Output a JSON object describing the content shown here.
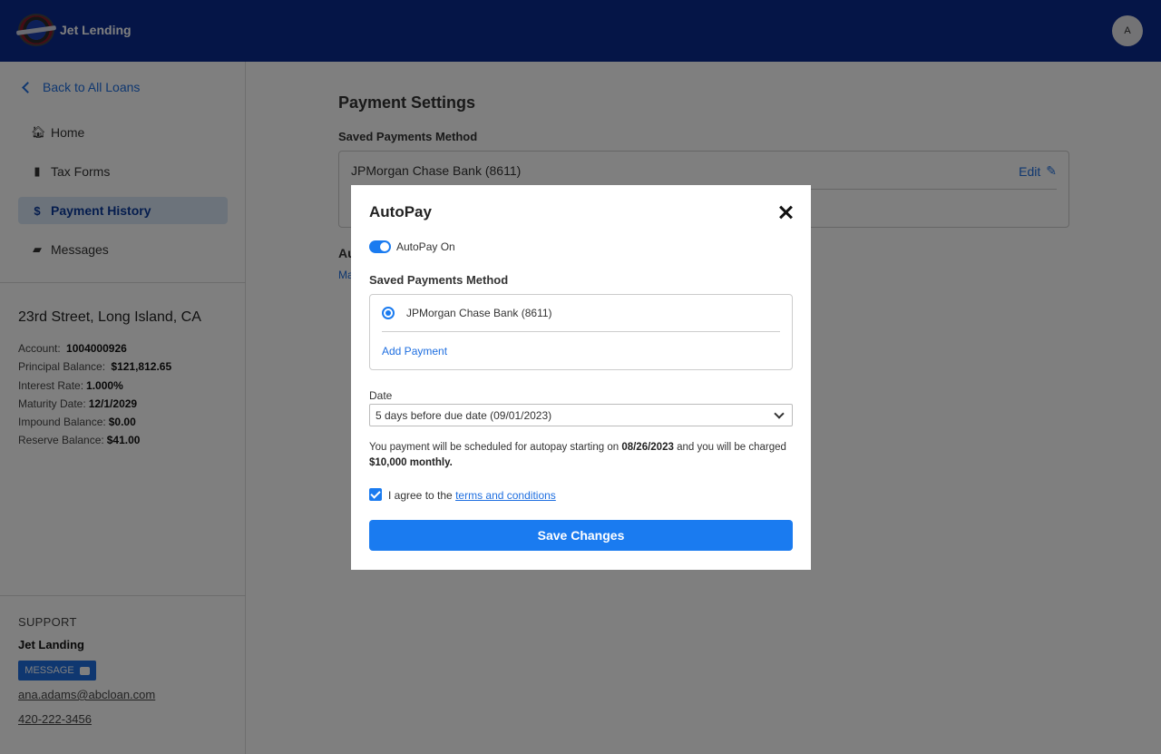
{
  "header": {
    "brand": "Jet Lending",
    "avatar_initial": "A"
  },
  "sidebar": {
    "back_label": "Back to All Loans",
    "items": [
      {
        "label": "Home",
        "icon": "home-icon",
        "active": false
      },
      {
        "label": "Tax Forms",
        "icon": "document-icon",
        "active": false
      },
      {
        "label": "Payment History",
        "icon": "dollar-icon",
        "active": true
      },
      {
        "label": "Messages",
        "icon": "chat-icon",
        "active": false
      }
    ],
    "address": "23rd Street, Long Island, CA",
    "loan": {
      "account_label": "Account:",
      "account_value": "1004000926",
      "principal_label": "Principal Balance:",
      "principal_value": "$121,812.65",
      "interest_label": "Interest Rate:",
      "interest_value": "1.000%",
      "maturity_label": "Maturity Date:",
      "maturity_value": "12/1/2029",
      "impound_label": "Impound Balance:",
      "impound_value": "$0.00",
      "reserve_label": "Reserve Balance:",
      "reserve_value": "$41.00"
    },
    "support": {
      "heading": "SUPPORT",
      "name": "Jet Landing",
      "message_button": "MESSAGE",
      "email": "ana.adams@abcloan.com",
      "phone": "420-222-3456"
    }
  },
  "main": {
    "title": "Payment Settings",
    "saved_heading": "Saved Payments Method",
    "saved_bank": "JPMorgan Chase Bank (8611)",
    "edit_label": "Edit",
    "autopay_fragment": "Au",
    "manage_fragment": "Ma"
  },
  "modal": {
    "title": "AutoPay",
    "toggle_label": "AutoPay On",
    "toggle_on": true,
    "saved_heading": "Saved Payments Method",
    "bank": "JPMorgan Chase Bank (8611)",
    "add_payment": "Add Payment",
    "date_label": "Date",
    "date_value": "5 days before due date (09/01/2023)",
    "note_prefix": "You payment will be scheduled for autopay starting on ",
    "note_date": "08/26/2023",
    "note_mid": " and you will be charged ",
    "note_amount": "$10,000 monthly.",
    "agree_prefix": "I agree to the ",
    "agree_link": "terms and conditions",
    "save_label": "Save Changes"
  },
  "colors": {
    "header_bg": "#0b2a8f",
    "accent": "#1a7bf0",
    "active_nav_bg": "#d8e6f7"
  }
}
